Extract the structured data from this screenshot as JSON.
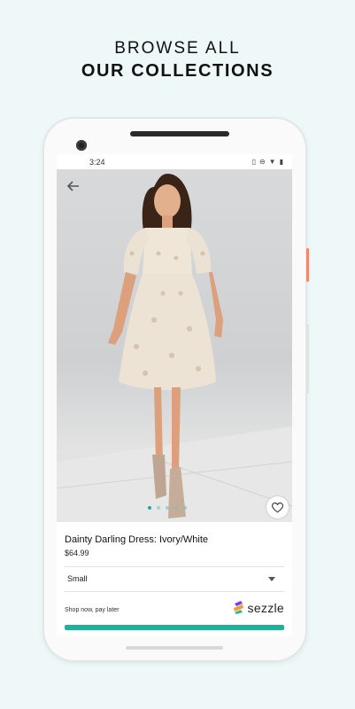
{
  "promo": {
    "line1": "BROWSE ALL",
    "line2": "OUR COLLECTIONS"
  },
  "status_bar": {
    "time": "3:24",
    "icons": [
      "vibrate-icon",
      "do-not-disturb-icon",
      "wifi-icon",
      "battery-icon"
    ]
  },
  "product": {
    "title": "Dainty Darling Dress: Ivory/White",
    "price": "$64.99",
    "image_count": 5,
    "active_image": 1
  },
  "size_select": {
    "value": "Small"
  },
  "payment": {
    "pay_later_text": "Shop now, pay later",
    "provider": "sezzle"
  },
  "colors": {
    "background": "#eef8f9",
    "accent": "#20b19d",
    "power_button": "#f08a6a"
  }
}
